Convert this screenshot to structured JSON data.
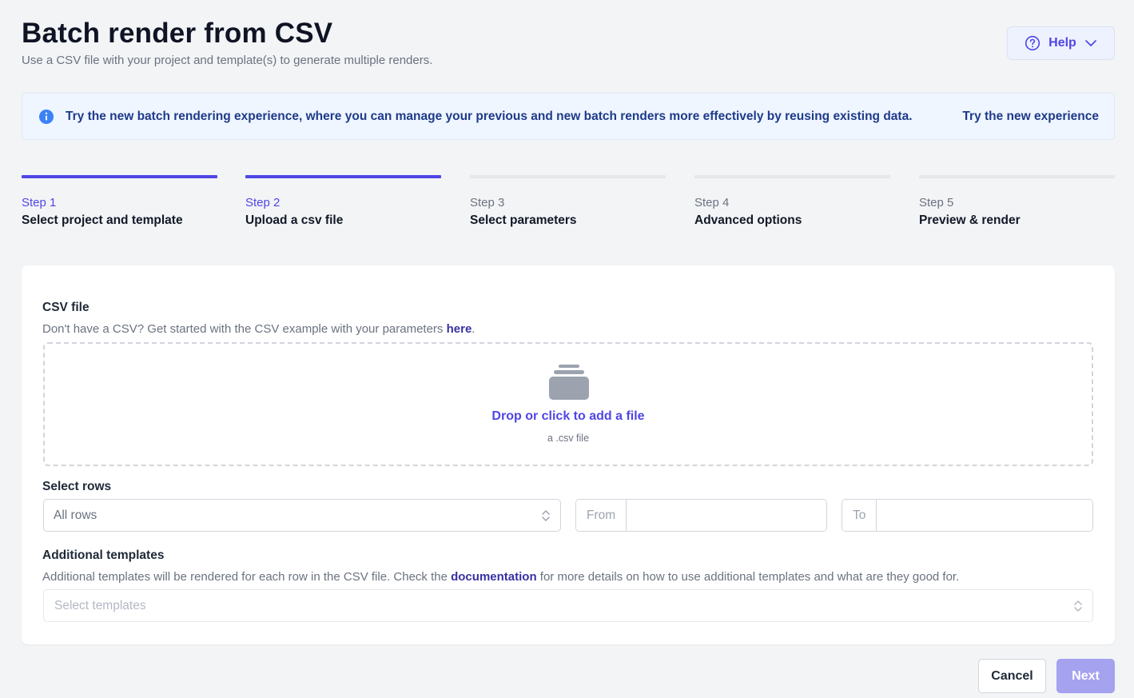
{
  "header": {
    "title": "Batch render from CSV",
    "subtitle": "Use a CSV file with your project and template(s) to generate multiple renders.",
    "help_label": "Help"
  },
  "banner": {
    "icon": "info-icon",
    "text": "Try the new batch rendering experience, where you can manage your previous and new batch renders more effectively by reusing existing data.",
    "link": "Try the new experience"
  },
  "steps": [
    {
      "num": "Step 1",
      "name": "Select project and template",
      "active": true
    },
    {
      "num": "Step 2",
      "name": "Upload a csv file",
      "active": true
    },
    {
      "num": "Step 3",
      "name": "Select parameters",
      "active": false
    },
    {
      "num": "Step 4",
      "name": "Advanced options",
      "active": false
    },
    {
      "num": "Step 5",
      "name": "Preview & render",
      "active": false
    }
  ],
  "csv": {
    "label": "CSV file",
    "help_prefix": "Don't have a CSV? Get started with the CSV example with your parameters ",
    "help_link": "here",
    "help_suffix": ".",
    "drop_main": "Drop or click to add a file",
    "drop_sub": "a .csv file"
  },
  "rows": {
    "label": "Select rows",
    "selected": "All rows",
    "from_label": "From",
    "from_value": "",
    "to_label": "To",
    "to_value": ""
  },
  "templates": {
    "label": "Additional templates",
    "help_prefix": "Additional templates will be rendered for each row in the CSV file. Check the ",
    "help_link": "documentation",
    "help_suffix": " for more details on how to use additional templates and what are they good for.",
    "placeholder": "Select templates"
  },
  "footer": {
    "cancel": "Cancel",
    "next": "Next"
  },
  "colors": {
    "accent": "#4f46e5",
    "next_disabled": "#a5a2f0",
    "banner_bg": "#eff6ff",
    "banner_text": "#1e3a8a",
    "info_icon": "#3b82f6"
  }
}
